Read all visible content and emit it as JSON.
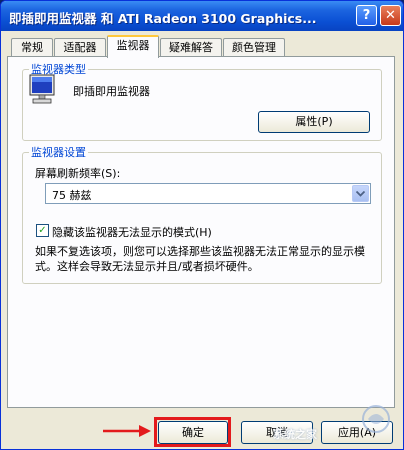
{
  "window": {
    "title": "即插即用监视器 和 ATI Radeon 3100 Graphics...",
    "help_button": "?",
    "close_button": "✕"
  },
  "tabs": [
    {
      "label": "常规",
      "active": false
    },
    {
      "label": "适配器",
      "active": false
    },
    {
      "label": "监视器",
      "active": true
    },
    {
      "label": "疑难解答",
      "active": false
    },
    {
      "label": "颜色管理",
      "active": false
    }
  ],
  "monitor_type": {
    "group_label": "监视器类型",
    "icon": "monitor-icon",
    "name": "即插即用监视器",
    "properties_button": "属性(P)"
  },
  "monitor_settings": {
    "group_label": "监视器设置",
    "refresh_rate_label": "屏幕刷新频率(S):",
    "refresh_rate_value": "75 赫兹",
    "hide_modes_checked": true,
    "hide_modes_label": "隐藏该监视器无法显示的模式(H)",
    "help_text": "如果不复选该项，则您可以选择那些该监视器无法正常显示的显示模式。这样会导致无法显示并且/或者损坏硬件。"
  },
  "footer": {
    "ok_button": "确定",
    "cancel_button": "取消",
    "apply_button": "应用(A)"
  },
  "annotation": {
    "highlight_color": "#e31a1c",
    "watermark_text": "系统之家"
  }
}
